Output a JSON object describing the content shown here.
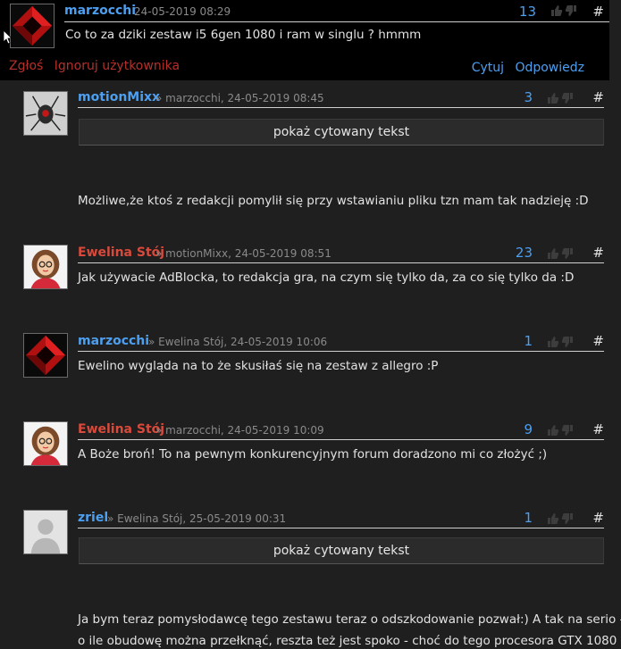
{
  "colors": {
    "link_blue": "#4d9ff0",
    "author_red": "#d84a3c",
    "action_red": "#b5302a",
    "background": "#1f1f1f",
    "top_background": "#000000"
  },
  "top_post": {
    "author": "marzocchi",
    "date": "24-05-2019 08:29",
    "score": "13",
    "permalink": "#",
    "body": "Co to za dziki zestaw i5 6gen 1080 i ram w singlu ? hmmm",
    "report_label": "Zgłoś",
    "ignore_label": "Ignoruj użytkownika",
    "quote_label": "Cytuj",
    "reply_label": "Odpowiedz",
    "avatar_icon": "red-diamond-avatar"
  },
  "replies": [
    {
      "author": "motionMixx",
      "meta": "» marzocchi, 24-05-2019 08:45",
      "score": "3",
      "permalink": "#",
      "quote_toggle": "pokaż cytowany tekst",
      "body": "Możliwe,że ktoś z redakcji pomylił się przy wstawianiu pliku tzn mam tak nadzieję :D",
      "avatar_icon": "spider-avatar"
    },
    {
      "author": "Ewelina Stój",
      "meta": "» motionMixx, 24-05-2019 08:51",
      "score": "23",
      "permalink": "#",
      "body": "Jak używacie AdBlocka, to redakcja gra, na czym się tylko da, za co się tylko da :D",
      "avatar_icon": "cartoon-woman-avatar"
    },
    {
      "author": "marzocchi",
      "meta": "» Ewelina Stój, 24-05-2019 10:06",
      "score": "1",
      "permalink": "#",
      "body": "Ewelino wygląda na to że skusiłaś się na zestaw z allegro :P",
      "avatar_icon": "red-diamond-avatar"
    },
    {
      "author": "Ewelina Stój",
      "meta": "» marzocchi, 24-05-2019 10:09",
      "score": "9",
      "permalink": "#",
      "body": "A Boże broń! To na pewnym konkurencyjnym forum doradzono mi co złożyć ;)",
      "avatar_icon": "cartoon-woman-avatar"
    },
    {
      "author": "zriel",
      "meta": "» Ewelina Stój, 25-05-2019 00:31",
      "score": "1",
      "permalink": "#",
      "quote_toggle": "pokaż cytowany tekst",
      "body": "Ja bym teraz pomysłodawcę tego zestawu teraz o odszkodowanie pozwał:) A tak na serio -",
      "body_line2": "o ile obudowę można przełknąć, reszta też jest spoko - choć do tego procesora GTX 1080",
      "avatar_icon": "default-user-avatar"
    }
  ]
}
